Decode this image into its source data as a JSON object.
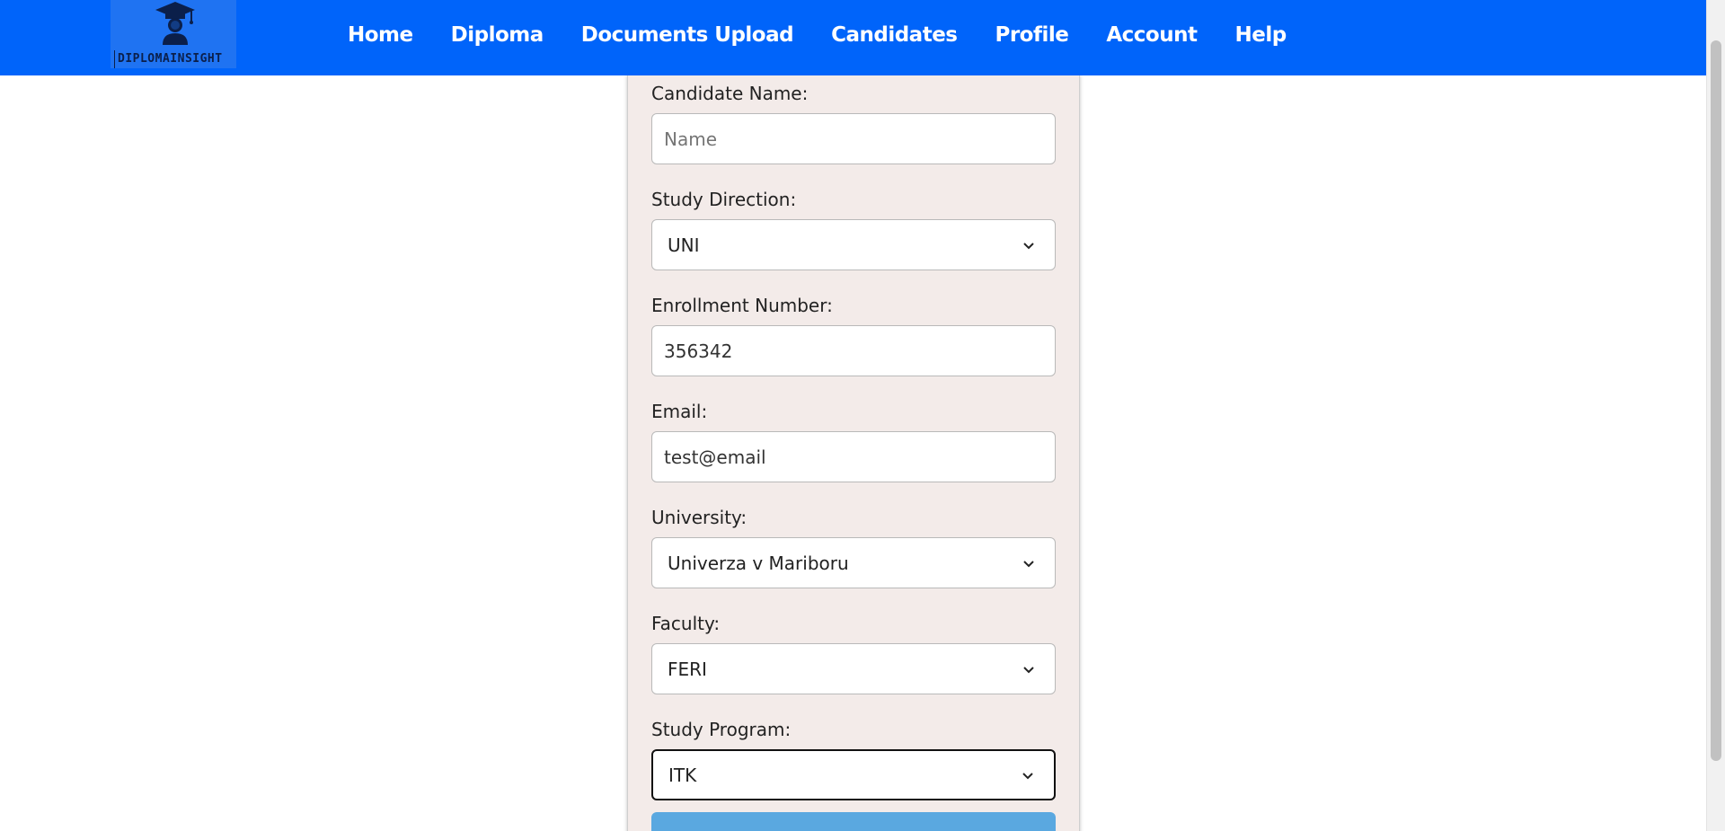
{
  "brand": {
    "name": "DIPLOMAINSIGHT",
    "logo_icon": "graduate-cap-icon"
  },
  "nav": {
    "items": [
      {
        "label": "Home"
      },
      {
        "label": "Diploma"
      },
      {
        "label": "Documents Upload"
      },
      {
        "label": "Candidates"
      },
      {
        "label": "Profile"
      },
      {
        "label": "Account"
      },
      {
        "label": "Help"
      }
    ]
  },
  "form": {
    "candidate_name": {
      "label": "Candidate Name:",
      "placeholder": "Name",
      "value": ""
    },
    "study_direction": {
      "label": "Study Direction:",
      "value": "UNI"
    },
    "enrollment_number": {
      "label": "Enrollment Number:",
      "value": "356342"
    },
    "email": {
      "label": "Email:",
      "value": "test@email"
    },
    "university": {
      "label": "University:",
      "value": "Univerza v Mariboru"
    },
    "faculty": {
      "label": "Faculty:",
      "value": "FERI"
    },
    "study_program": {
      "label": "Study Program:",
      "value": "ITK"
    }
  },
  "colors": {
    "navbar": "#0064fa",
    "form_background": "#f3ebe9",
    "submit_button": "#5aa8e0"
  }
}
